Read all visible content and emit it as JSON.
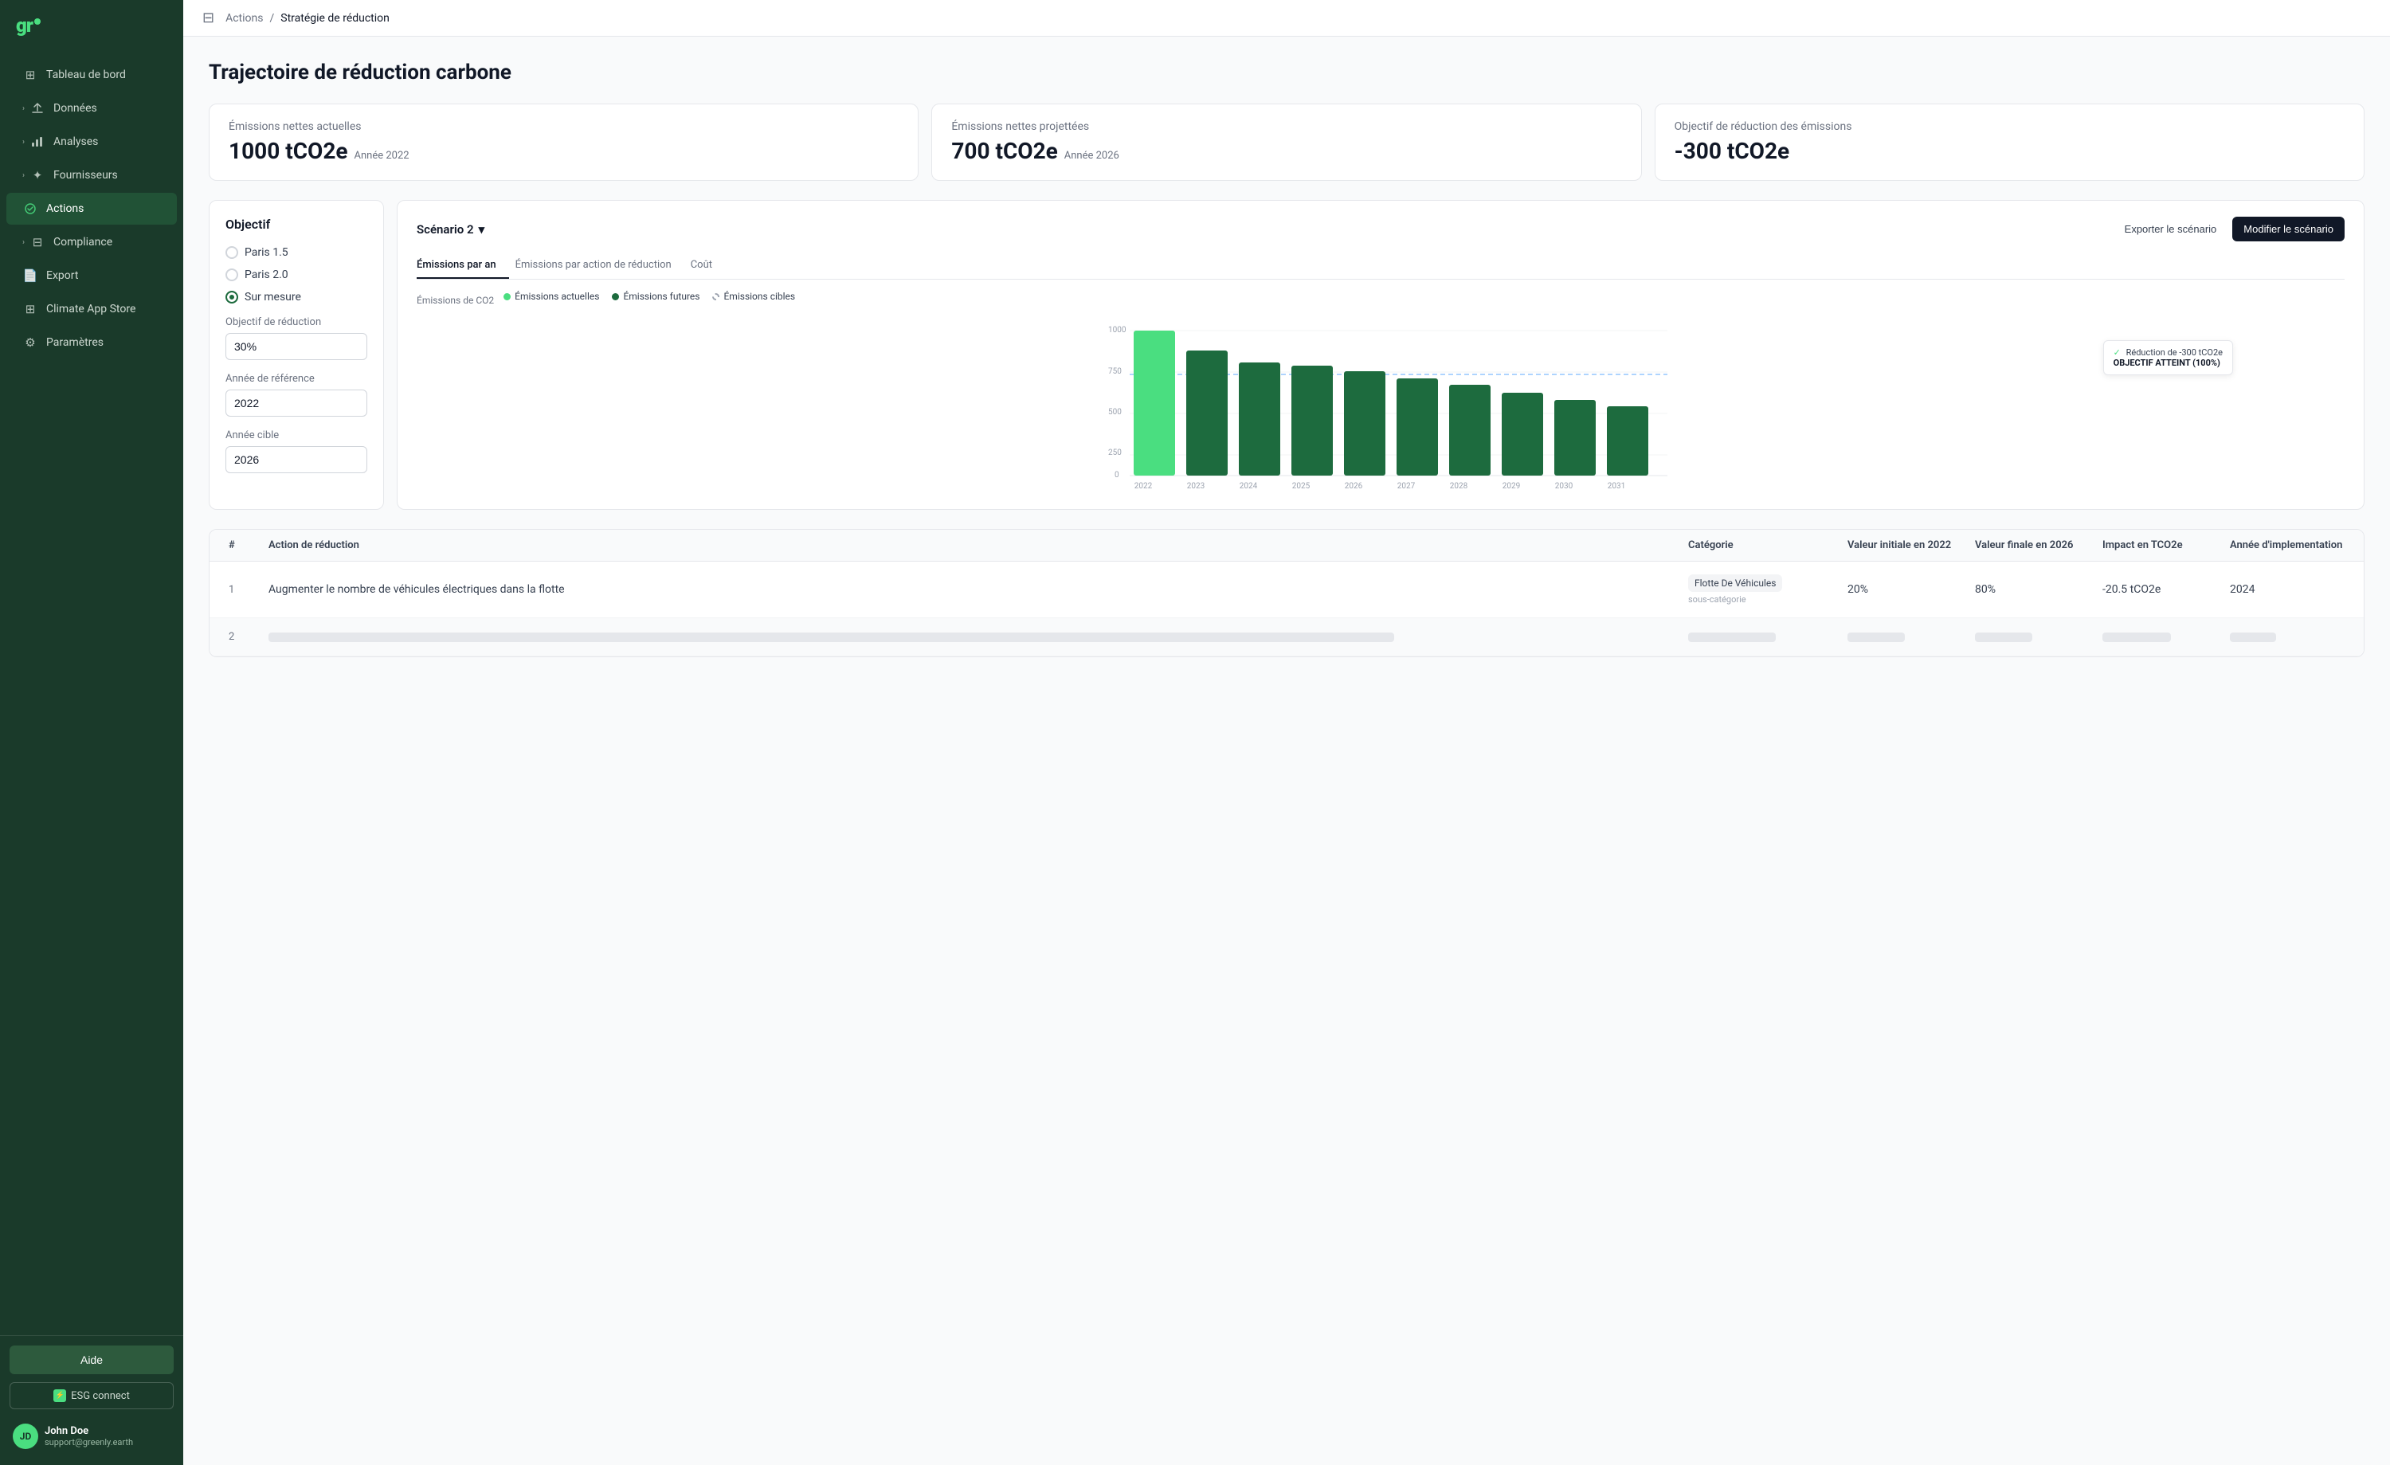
{
  "app": {
    "logo": "gr",
    "logo_dot": "·"
  },
  "sidebar": {
    "items": [
      {
        "id": "tableau",
        "label": "Tableau de bord",
        "icon": "⊞",
        "active": false,
        "chevron": false
      },
      {
        "id": "donnees",
        "label": "Données",
        "icon": "↑",
        "active": false,
        "chevron": true
      },
      {
        "id": "analyses",
        "label": "Analyses",
        "icon": "📊",
        "active": false,
        "chevron": true
      },
      {
        "id": "fournisseurs",
        "label": "Fournisseurs",
        "icon": "✦",
        "active": false,
        "chevron": true
      },
      {
        "id": "actions",
        "label": "Actions",
        "icon": "~",
        "active": true,
        "chevron": false
      },
      {
        "id": "compliance",
        "label": "Compliance",
        "icon": "⊟",
        "active": false,
        "chevron": true
      },
      {
        "id": "export",
        "label": "Export",
        "icon": "📄",
        "active": false,
        "chevron": false
      },
      {
        "id": "climate",
        "label": "Climate App Store",
        "icon": "⊞",
        "active": false,
        "chevron": false
      },
      {
        "id": "parametres",
        "label": "Paramètres",
        "icon": "⚙",
        "active": false,
        "chevron": false
      }
    ],
    "help_label": "Aide",
    "esg_label": "ESG connect",
    "user": {
      "name": "John Doe",
      "email": "support@greenly.earth",
      "initials": "JD"
    }
  },
  "breadcrumb": {
    "parent": "Actions",
    "current": "Stratégie de réduction"
  },
  "page": {
    "title": "Trajectoire de réduction carbone"
  },
  "stats": [
    {
      "label": "Émissions nettes actuelles",
      "value": "1000 tCO2e",
      "year_label": "Année 2022"
    },
    {
      "label": "Émissions nettes projettées",
      "value": "700 tCO2e",
      "year_label": "Année 2026"
    },
    {
      "label": "Objectif de réduction des émissions",
      "value": "-300 tCO2e",
      "year_label": ""
    }
  ],
  "objectif": {
    "title": "Objectif",
    "options": [
      {
        "id": "paris15",
        "label": "Paris 1.5",
        "selected": false
      },
      {
        "id": "paris20",
        "label": "Paris 2.0",
        "selected": false
      },
      {
        "id": "surMesure",
        "label": "Sur mesure",
        "selected": true
      }
    ],
    "fields": [
      {
        "label": "Objectif de réduction",
        "value": "30%"
      },
      {
        "label": "Année de référence",
        "value": "2022"
      },
      {
        "label": "Année cible",
        "value": "2026"
      }
    ]
  },
  "chart": {
    "scenario_label": "Scénario 2",
    "export_btn": "Exporter le scénario",
    "modify_btn": "Modifier le scénario",
    "tabs": [
      {
        "label": "Émissions par an",
        "active": true
      },
      {
        "label": "Émissions par action de réduction",
        "active": false
      },
      {
        "label": "Coût",
        "active": false
      }
    ],
    "y_axis_label": "Émissions de CO2",
    "legend": [
      {
        "type": "actual",
        "label": "Émissions actuelles"
      },
      {
        "type": "future",
        "label": "Émissions futures"
      },
      {
        "type": "target",
        "label": "Émissions cibles"
      }
    ],
    "tooltip": {
      "reduction": "Réduction de -300 tCO2e",
      "status": "OBJECTIF ATTEINT (100%)"
    },
    "bars": [
      {
        "year": "2022",
        "value": 1000,
        "type": "actual"
      },
      {
        "year": "2023",
        "value": 850,
        "type": "future"
      },
      {
        "year": "2024",
        "value": 780,
        "type": "future"
      },
      {
        "year": "2025",
        "value": 760,
        "type": "future"
      },
      {
        "year": "2026",
        "value": 720,
        "type": "future"
      },
      {
        "year": "2027",
        "value": 670,
        "type": "future"
      },
      {
        "year": "2028",
        "value": 630,
        "type": "future"
      },
      {
        "year": "2029",
        "value": 570,
        "type": "future"
      },
      {
        "year": "2030",
        "value": 520,
        "type": "future"
      },
      {
        "year": "2031",
        "value": 480,
        "type": "future"
      }
    ],
    "y_ticks": [
      0,
      250,
      500,
      750,
      1000
    ],
    "target_line": 700
  },
  "table": {
    "headers": [
      "#",
      "Action de réduction",
      "Catégorie",
      "Valeur initiale en 2022",
      "Valeur finale en 2026",
      "Impact en TCO2e",
      "Année d'implementation"
    ],
    "rows": [
      {
        "num": "1",
        "action": "Augmenter le nombre de véhicules électriques dans la flotte",
        "category": "Flotte De Véhicules",
        "subcategory": "sous-catégorie",
        "initial_value": "20%",
        "final_value": "80%",
        "impact": "-20.5 tCO2e",
        "year": "2024"
      },
      {
        "num": "2",
        "action": "",
        "category": "",
        "subcategory": "",
        "initial_value": "",
        "final_value": "",
        "impact": "",
        "year": ""
      }
    ]
  }
}
